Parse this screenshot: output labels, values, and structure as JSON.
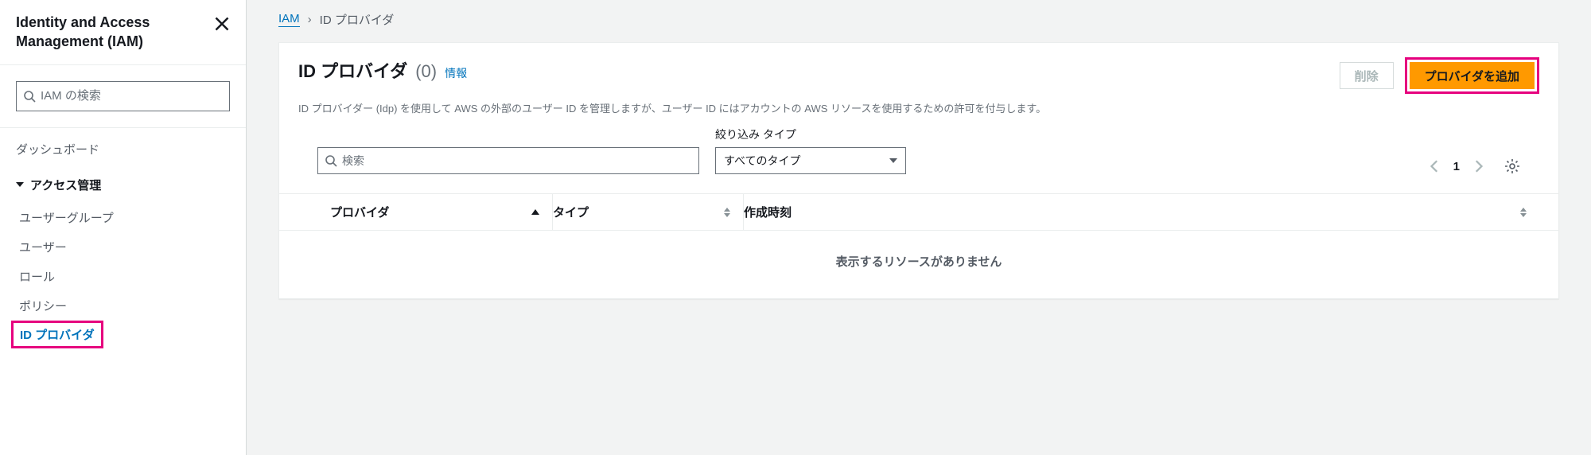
{
  "sidebar": {
    "title": "Identity and Access Management (IAM)",
    "search_placeholder": "IAM の検索",
    "nav": {
      "dashboard": "ダッシュボード",
      "access_group": "アクセス管理",
      "items": [
        {
          "label": "ユーザーグループ"
        },
        {
          "label": "ユーザー"
        },
        {
          "label": "ロール"
        },
        {
          "label": "ポリシー"
        },
        {
          "label": "ID プロバイダ"
        }
      ]
    }
  },
  "breadcrumbs": {
    "root": "IAM",
    "current": "ID プロバイダ"
  },
  "panel": {
    "title": "ID プロバイダ",
    "count": "(0)",
    "info": "情報",
    "description": "ID プロバイダー (Idp) を使用して AWS の外部のユーザー ID を管理しますが、ユーザー ID にはアカウントの AWS リソースを使用するための許可を付与します。",
    "delete_label": "削除",
    "add_label": "プロバイダを追加",
    "filter": {
      "search_placeholder": "検索",
      "type_label": "絞り込み タイプ",
      "type_selected": "すべてのタイプ"
    },
    "pager": {
      "page": "1"
    },
    "columns": {
      "provider": "プロバイダ",
      "type": "タイプ",
      "created": "作成時刻"
    },
    "empty": "表示するリソースがありません"
  }
}
